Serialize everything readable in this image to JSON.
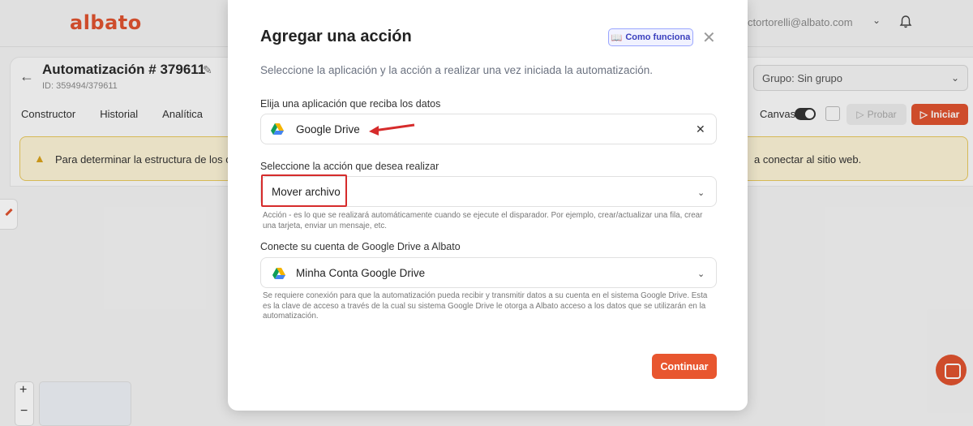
{
  "app": {
    "logo": "albato",
    "user_email": "ctortorelli@albato.com",
    "automation_title": "Automatización # 379611",
    "automation_id": "ID: 359494/379611",
    "tabs": [
      "Constructor",
      "Historial",
      "Analítica"
    ],
    "group_select": "Grupo: Sin grupo",
    "canvas_label": "Canvas",
    "probar_label": "Probar",
    "iniciar_label": "Iniciar",
    "warning_left": "Para determinar la estructura de los c",
    "warning_right": "a conectar al sitio web.",
    "zoom_plus": "+",
    "zoom_minus": "−"
  },
  "modal": {
    "title": "Agregar una acción",
    "how_it_works": "Como funciona",
    "subtitle": "Seleccione la aplicación y la acción a realizar una vez iniciada la automatización.",
    "app_label": "Elija una aplicación que reciba los datos",
    "app_value": "Google Drive",
    "action_label": "Seleccione la acción que desea realizar",
    "action_value": "Mover archivo",
    "action_hint": "Acción - es lo que se realizará automáticamente cuando se ejecute el disparador. Por ejemplo, crear/actualizar una fila, crear una tarjeta, enviar un mensaje, etc.",
    "account_label": "Conecte su cuenta de Google Drive a Albato",
    "account_value": "Minha Conta Google Drive",
    "account_hint": "Se requiere conexión para que la automatización pueda recibir y transmitir datos a su cuenta en el sistema Google Drive. Esta es la clave de acceso a través de la cual su sistema Google Drive le otorga a Albato acceso a los datos que se utilizarán en la automatización.",
    "continue_label": "Continuar"
  },
  "colors": {
    "brand": "#e0532f",
    "annotation_red": "#d62b2b",
    "how_it_works_accent": "#3a3fbd"
  }
}
